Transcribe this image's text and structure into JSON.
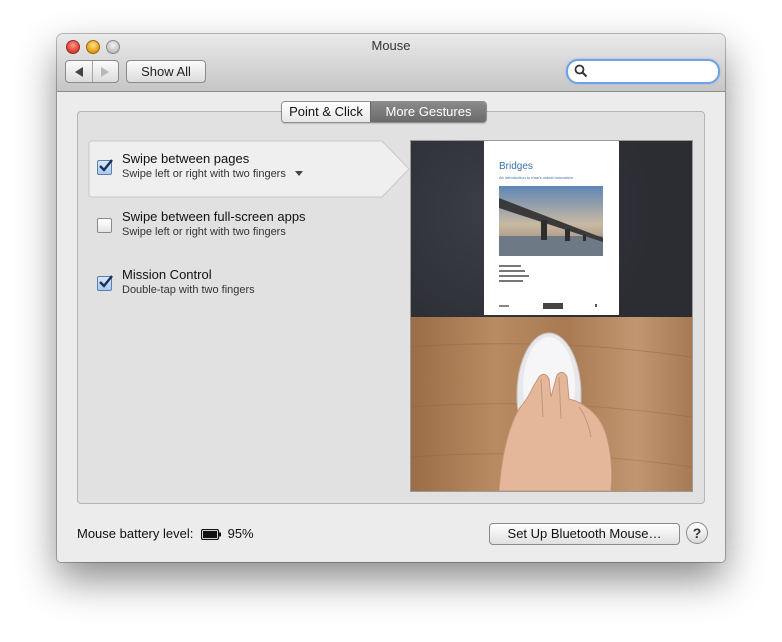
{
  "window": {
    "title": "Mouse"
  },
  "toolbar": {
    "show_all_label": "Show All",
    "search_placeholder": ""
  },
  "tabs": [
    {
      "label": "Point & Click",
      "selected": false
    },
    {
      "label": "More Gestures",
      "selected": true
    }
  ],
  "gestures": [
    {
      "title": "Swipe between pages",
      "subtitle": "Swipe left or right with two fingers",
      "checked": true,
      "has_dropdown": true,
      "selected": true
    },
    {
      "title": "Swipe between full-screen apps",
      "subtitle": "Swipe left or right with two fingers",
      "checked": false,
      "has_dropdown": false,
      "selected": false
    },
    {
      "title": "Mission Control",
      "subtitle": "Double-tap with two fingers",
      "checked": true,
      "has_dropdown": false,
      "selected": false
    }
  ],
  "preview": {
    "page_title": "Bridges",
    "page_subtitle": "An introduction to man's oldest innovation"
  },
  "footer": {
    "battery_label": "Mouse battery level:",
    "battery_value": "95%",
    "setup_button_label": "Set Up Bluetooth Mouse…"
  },
  "help_label": "?",
  "colors": {
    "accent": "#6ea2e2",
    "active_tab": "#6f6f6f",
    "checkbox_checked": "#a9c9ef"
  }
}
